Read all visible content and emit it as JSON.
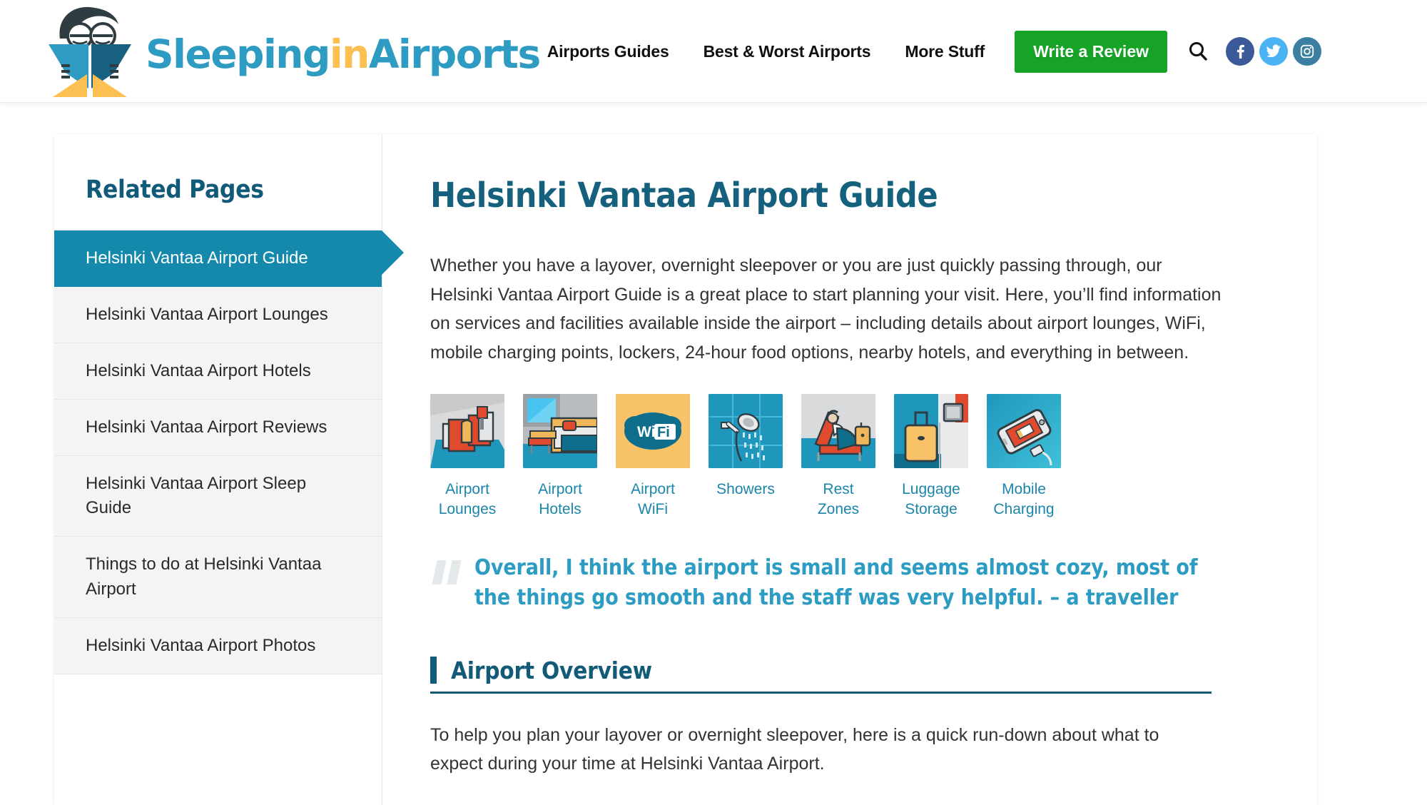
{
  "header": {
    "logo": {
      "mascot_icon": "sleeping-owl-logo-icon",
      "text_part1": "Sleeping",
      "text_part2": "in",
      "text_part3": "Airports"
    },
    "nav": [
      {
        "label": "Airports Guides"
      },
      {
        "label": "Best & Worst Airports"
      },
      {
        "label": "More Stuff"
      }
    ],
    "review_button": "Write a Review",
    "search_icon": "search-icon",
    "socials": [
      {
        "name": "facebook",
        "glyph": "f",
        "color": "#3b5a9a"
      },
      {
        "name": "twitter",
        "glyph": "t",
        "color": "#4ab3f4"
      },
      {
        "name": "instagram",
        "glyph": "i",
        "color": "#3a7fa0"
      }
    ]
  },
  "sidebar": {
    "title": "Related Pages",
    "items": [
      {
        "label": "Helsinki Vantaa Airport Guide",
        "active": true
      },
      {
        "label": "Helsinki Vantaa Airport Lounges",
        "active": false
      },
      {
        "label": "Helsinki Vantaa Airport Hotels",
        "active": false
      },
      {
        "label": "Helsinki Vantaa Airport Reviews",
        "active": false
      },
      {
        "label": "Helsinki Vantaa Airport Sleep Guide",
        "active": false
      },
      {
        "label": "Things to do at Helsinki Vantaa Airport",
        "active": false
      },
      {
        "label": "Helsinki Vantaa Airport Photos",
        "active": false
      }
    ]
  },
  "main": {
    "page_title": "Helsinki Vantaa Airport Guide",
    "intro": "Whether you have a layover, overnight sleepover or you are just quickly passing through, our Helsinki Vantaa Airport Guide is a great place to start planning your visit.  Here, you’ll find information on services and facilities available inside the airport – including details about airport lounges, WiFi, mobile charging points, lockers, 24-hour food options, nearby hotels, and everything in between.",
    "tiles": [
      {
        "label": "Airport Lounges",
        "icon": "lounge-chairs-icon"
      },
      {
        "label": "Airport Hotels",
        "icon": "hotel-bed-icon"
      },
      {
        "label": "Airport WiFi",
        "icon": "wifi-icon"
      },
      {
        "label": "Showers",
        "icon": "shower-icon"
      },
      {
        "label": "Rest Zones",
        "icon": "rest-zone-icon"
      },
      {
        "label": "Luggage Storage",
        "icon": "luggage-storage-icon"
      },
      {
        "label": "Mobile Charging",
        "icon": "mobile-charging-icon"
      }
    ],
    "quote": "Overall, I think the airport is small and seems almost cozy, most of the things go smooth and the staff was very helpful. – a traveller",
    "section_title": "Airport Overview",
    "overview_text": "To help you plan your layover or overnight sleepover, here is a quick run-down about what to expect during your time at Helsinki Vantaa Airport."
  },
  "colors": {
    "brand_teal": "#1589ac",
    "brand_dark_teal": "#115a78",
    "link_teal": "#1b86ab",
    "accent_yellow": "#fbbf52",
    "review_green": "#16a326"
  }
}
